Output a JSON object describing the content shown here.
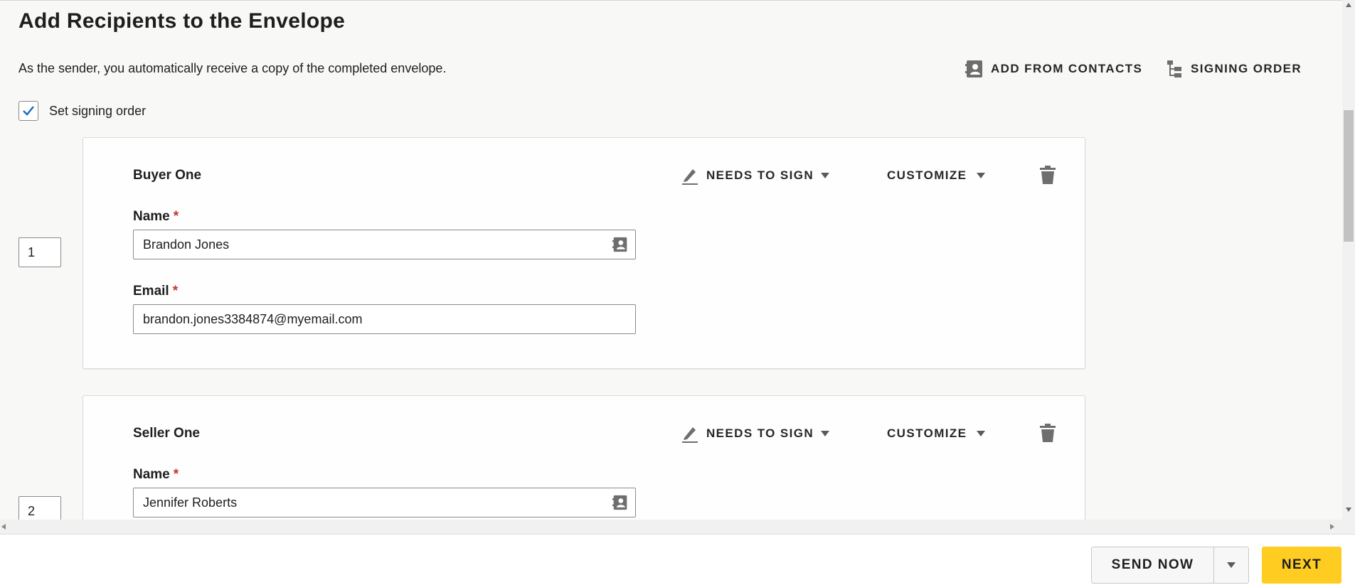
{
  "page": {
    "title": "Add Recipients to the Envelope",
    "subtitle": "As the sender, you automatically receive a copy of the completed envelope."
  },
  "top_actions": {
    "add_from_contacts": "ADD FROM CONTACTS",
    "signing_order": "SIGNING ORDER"
  },
  "signing_order_checkbox": {
    "label": "Set signing order",
    "checked": true
  },
  "recipients": [
    {
      "order": "1",
      "role_name": "Buyer One",
      "action": "NEEDS TO SIGN",
      "customize": "CUSTOMIZE",
      "name_label": "Name",
      "name_value": "Brandon Jones",
      "email_label": "Email",
      "email_value": "brandon.jones3384874@myemail.com",
      "required_marker": "*"
    },
    {
      "order": "2",
      "role_name": "Seller One",
      "action": "NEEDS TO SIGN",
      "customize": "CUSTOMIZE",
      "name_label": "Name",
      "name_value": "Jennifer Roberts",
      "required_marker": "*"
    }
  ],
  "footer": {
    "send_now": "SEND NOW",
    "next": "NEXT"
  },
  "colors": {
    "accent_next": "#ffcc22",
    "checkbox_check": "#1f6dc2",
    "required": "#c0362c",
    "icon_gray": "#6e6e6e"
  },
  "icons": [
    "contact-card-icon",
    "signing-order-icon",
    "checkmark-icon",
    "pen-icon",
    "trash-icon",
    "drag-handle-icon",
    "caret-down-icon"
  ]
}
